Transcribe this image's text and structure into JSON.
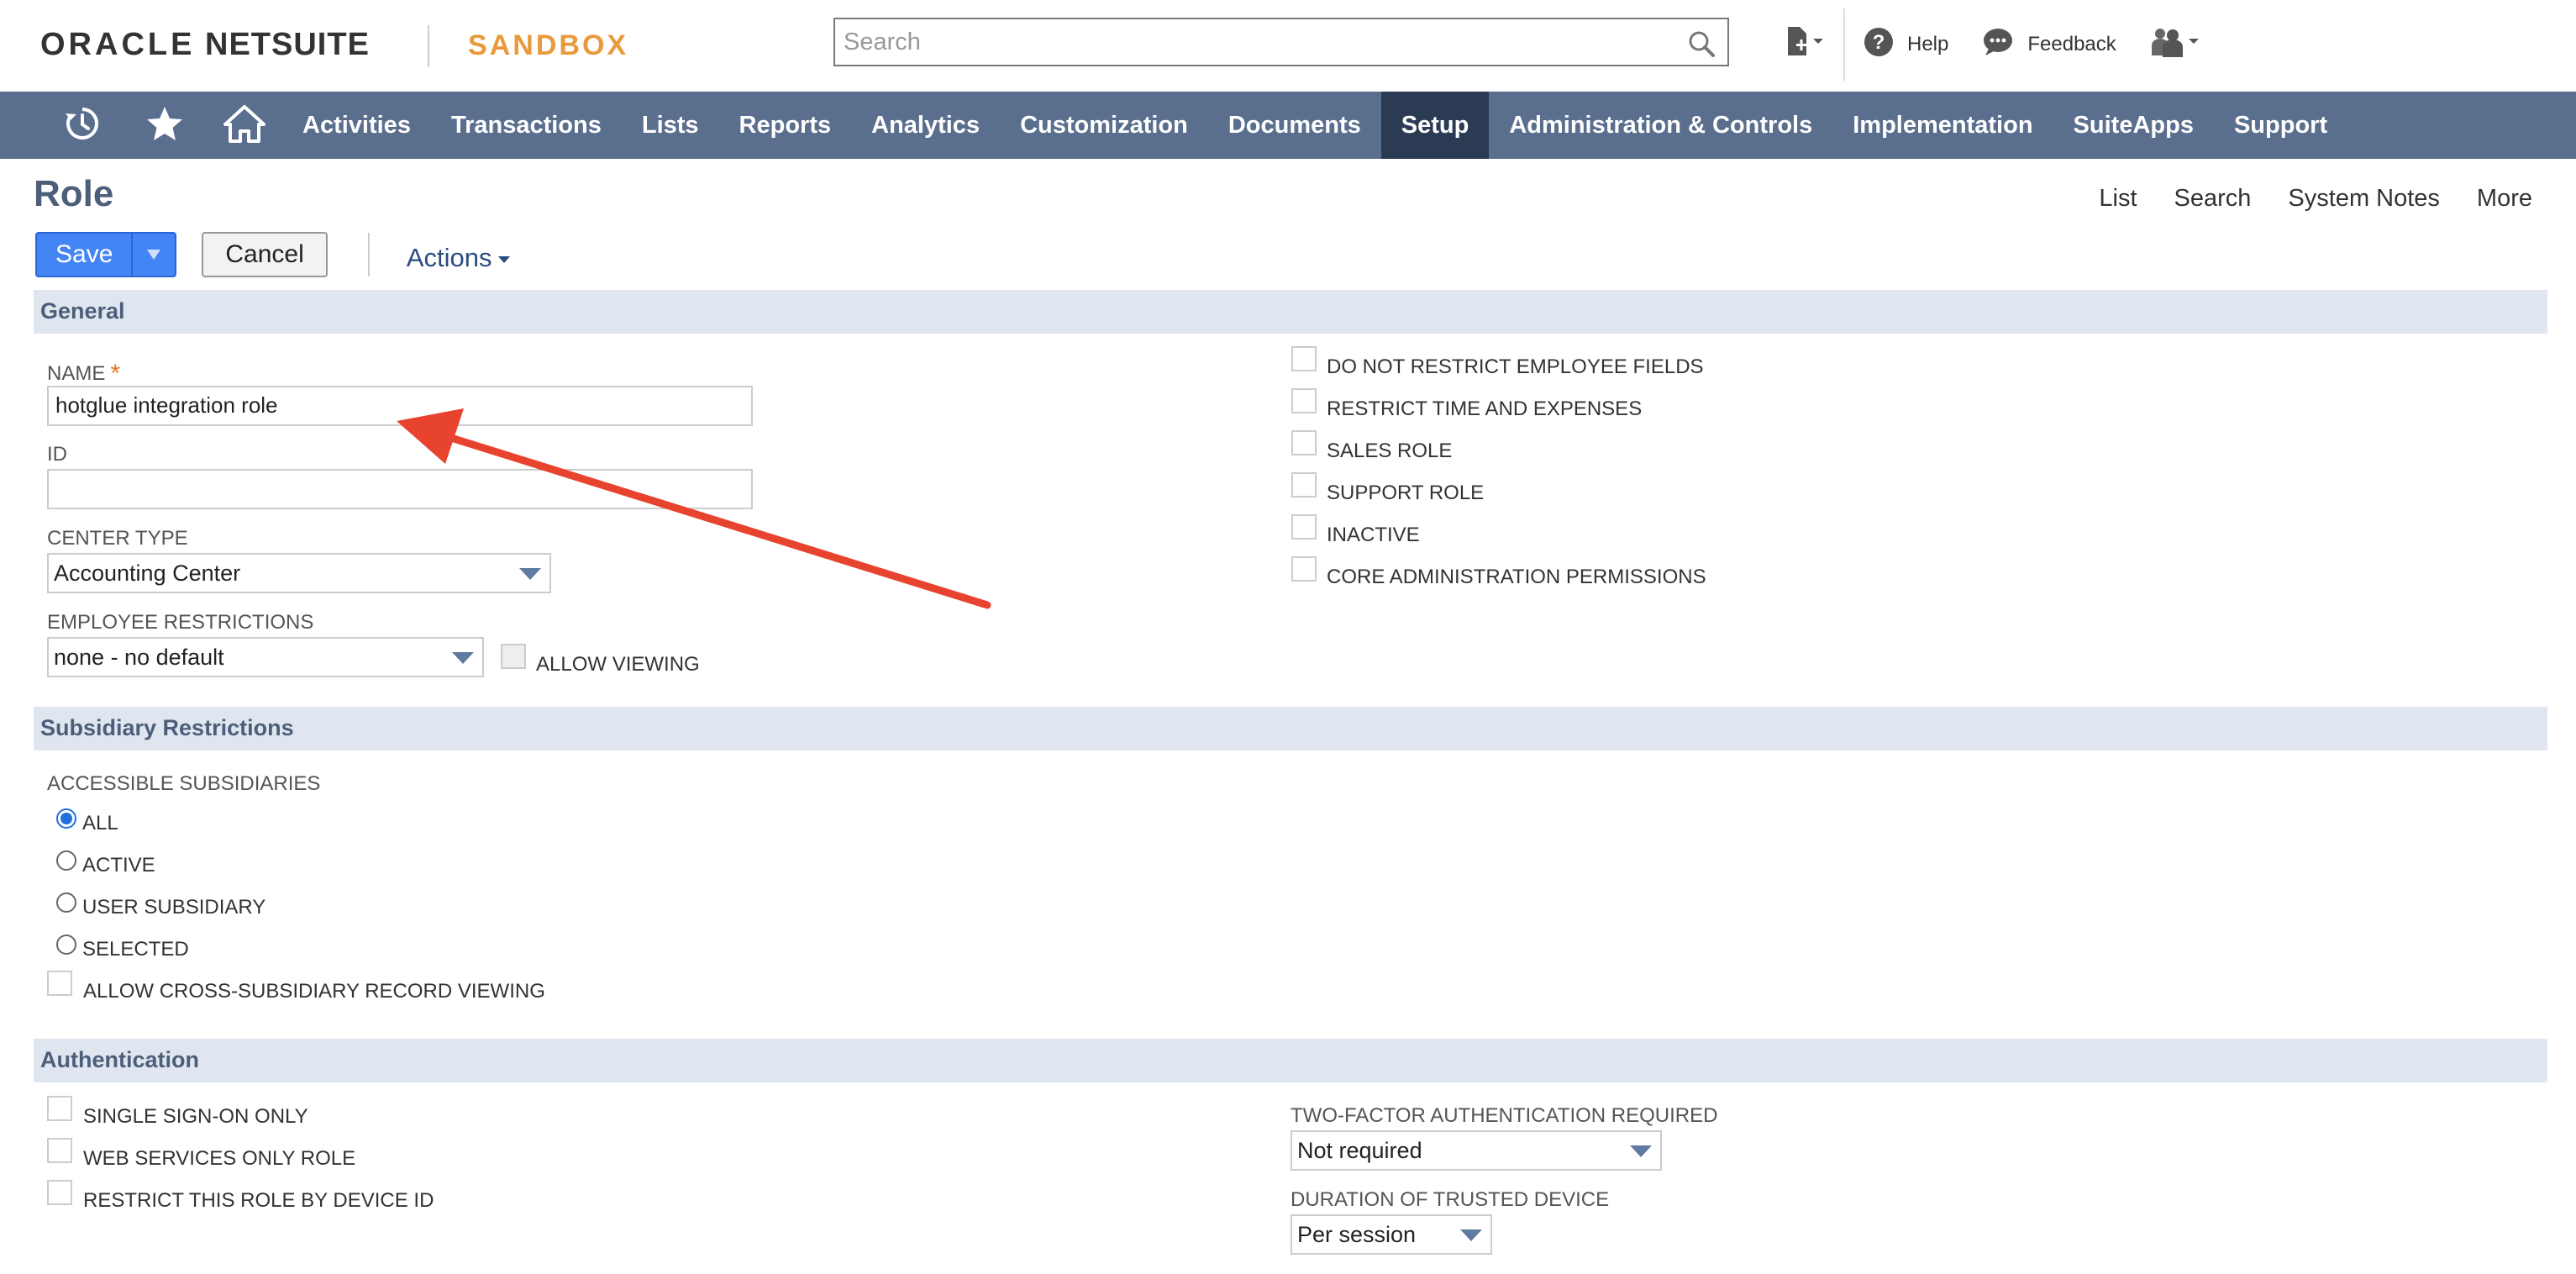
{
  "header": {
    "logo_oracle": "ORACLE",
    "logo_netsuite": "NETSUITE",
    "sandbox": "SANDBOX",
    "search_placeholder": "Search",
    "help": "Help",
    "feedback": "Feedback"
  },
  "nav": {
    "tabs": [
      "Activities",
      "Transactions",
      "Lists",
      "Reports",
      "Analytics",
      "Customization",
      "Documents",
      "Setup",
      "Administration & Controls",
      "Implementation",
      "SuiteApps",
      "Support"
    ],
    "active": "Setup"
  },
  "page": {
    "title": "Role",
    "links": [
      "List",
      "Search",
      "System Notes",
      "More"
    ],
    "save": "Save",
    "cancel": "Cancel",
    "actions": "Actions"
  },
  "general": {
    "heading": "General",
    "name_label": "NAME",
    "name_value": "hotglue integration role",
    "id_label": "ID",
    "id_value": "",
    "center_type_label": "CENTER TYPE",
    "center_type_value": "Accounting Center",
    "employee_restrictions_label": "EMPLOYEE RESTRICTIONS",
    "employee_restrictions_value": "none - no default",
    "allow_viewing": "ALLOW VIEWING",
    "checkboxes": [
      "DO NOT RESTRICT EMPLOYEE FIELDS",
      "RESTRICT TIME AND EXPENSES",
      "SALES ROLE",
      "SUPPORT ROLE",
      "INACTIVE",
      "CORE ADMINISTRATION PERMISSIONS"
    ]
  },
  "subsidiary": {
    "heading": "Subsidiary Restrictions",
    "accessible_label": "ACCESSIBLE SUBSIDIARIES",
    "options": [
      "ALL",
      "ACTIVE",
      "USER SUBSIDIARY",
      "SELECTED"
    ],
    "selected": "ALL",
    "cross_viewing": "ALLOW CROSS-SUBSIDIARY RECORD VIEWING"
  },
  "authentication": {
    "heading": "Authentication",
    "checkboxes": [
      "SINGLE SIGN-ON ONLY",
      "WEB SERVICES ONLY ROLE",
      "RESTRICT THIS ROLE BY DEVICE ID"
    ],
    "two_factor_label": "TWO-FACTOR AUTHENTICATION REQUIRED",
    "two_factor_value": "Not required",
    "trusted_device_label": "DURATION OF TRUSTED DEVICE",
    "trusted_device_value": "Per session"
  },
  "colors": {
    "nav_bg": "#5a6e8e",
    "nav_active": "#2b3b54",
    "section_bg": "#e0e6ef",
    "save_button": "#4385f5",
    "annotation_arrow": "#e8432f"
  }
}
